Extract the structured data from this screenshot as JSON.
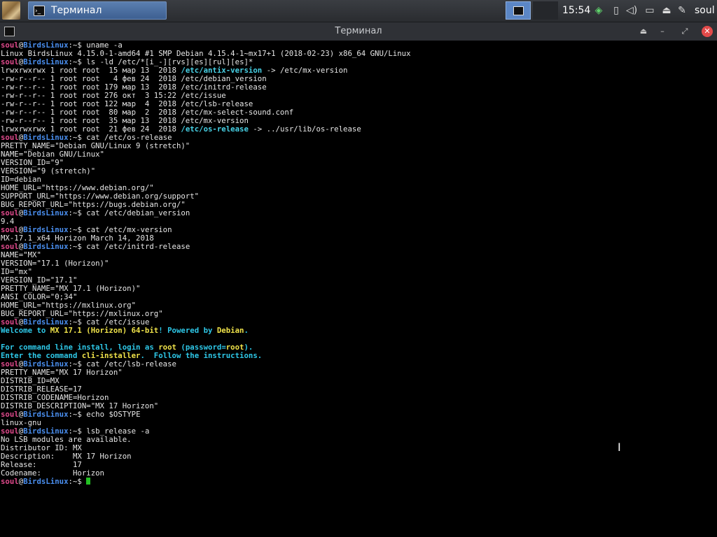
{
  "panel": {
    "task_title": "Терминал",
    "clock": "15:54",
    "user": "soul",
    "tray_icons": [
      "network-cube-icon",
      "clipboard-icon",
      "volume-icon",
      "battery-icon",
      "eject-icon",
      "pen-icon"
    ]
  },
  "window": {
    "title": "Терминал",
    "buttons": [
      "shade-icon",
      "minimize-icon",
      "maximize-icon",
      "close-icon"
    ]
  },
  "prompt": {
    "user": "soul",
    "at": "@",
    "host": "BirdsLinux",
    "suffix": ":~$ "
  },
  "terminal_lines": [
    {
      "cmd": "uname -a"
    },
    {
      "t": "Linux BirdsLinux 4.15.0-1-amd64 #1 SMP Debian 4.15.4-1~mx17+1 (2018-02-23) x86_64 GNU/Linux"
    },
    {
      "cmd": "ls -ld /etc/*[i_-][rvs][es][rul][es]*"
    },
    {
      "t": "lrwxrwxrwx 1 root root  15 мар 13  2018 ",
      "link": "/etc/antix-version",
      "t2": " -> /etc/mx-version"
    },
    {
      "t": "-rw-r--r-- 1 root root   4 фев 24  2018 /etc/debian_version"
    },
    {
      "t": "-rw-r--r-- 1 root root 179 мар 13  2018 /etc/initrd-release"
    },
    {
      "t": "-rw-r--r-- 1 root root 276 окт  3 15:22 /etc/issue"
    },
    {
      "t": "-rw-r--r-- 1 root root 122 мар  4  2018 /etc/lsb-release"
    },
    {
      "t": "-rw-r--r-- 1 root root  80 мар  2  2018 /etc/mx-select-sound.conf"
    },
    {
      "t": "-rw-r--r-- 1 root root  35 мар 13  2018 /etc/mx-version"
    },
    {
      "t": "lrwxrwxrwx 1 root root  21 фев 24  2018 ",
      "link": "/etc/os-release",
      "t2": " -> ../usr/lib/os-release"
    },
    {
      "cmd": "cat /etc/os-release"
    },
    {
      "t": "PRETTY_NAME=\"Debian GNU/Linux 9 (stretch)\""
    },
    {
      "t": "NAME=\"Debian GNU/Linux\""
    },
    {
      "t": "VERSION_ID=\"9\""
    },
    {
      "t": "VERSION=\"9 (stretch)\""
    },
    {
      "t": "ID=debian"
    },
    {
      "t": "HOME_URL=\"https://www.debian.org/\""
    },
    {
      "t": "SUPPORT_URL=\"https://www.debian.org/support\""
    },
    {
      "t": "BUG_REPORT_URL=\"https://bugs.debian.org/\""
    },
    {
      "cmd": "cat /etc/debian_version"
    },
    {
      "t": "9.4"
    },
    {
      "cmd": "cat /etc/mx-version"
    },
    {
      "t": "MX-17.1_x64 Horizon March 14, 2018"
    },
    {
      "cmd": "cat /etc/initrd-release"
    },
    {
      "t": "NAME=\"MX\""
    },
    {
      "t": "VERSION=\"17.1 (Horizon)\""
    },
    {
      "t": "ID=\"mx\""
    },
    {
      "t": "VERSION_ID=\"17.1\""
    },
    {
      "t": "PRETTY_NAME=\"MX 17.1 (Horizon)\""
    },
    {
      "t": "ANSI_COLOR=\"0;34\""
    },
    {
      "t": "HOME_URL=\"https://mxlinux.org\""
    },
    {
      "t": "BUG_REPORT_URL=\"https://mxlinux.org\""
    },
    {
      "cmd": "cat /etc/issue"
    },
    {
      "parts": [
        [
          "c",
          "Welcome to "
        ],
        [
          "y",
          "MX 17.1 (Horizon) 64-bit"
        ],
        [
          "c",
          "! Powered by "
        ],
        [
          "y",
          "Debian"
        ],
        [
          "c",
          "."
        ]
      ]
    },
    {
      "t": ""
    },
    {
      "parts": [
        [
          "c",
          "For command line install, login as "
        ],
        [
          "y",
          "root"
        ],
        [
          "c",
          " (password="
        ],
        [
          "y",
          "root"
        ],
        [
          "c",
          ")."
        ]
      ]
    },
    {
      "parts": [
        [
          "c",
          "Enter the command "
        ],
        [
          "y",
          "cli-installer"
        ],
        [
          "c",
          ".  Follow the instructions."
        ]
      ]
    },
    {
      "cmd": "cat /etc/lsb-release"
    },
    {
      "t": "PRETTY_NAME=\"MX 17 Horizon\""
    },
    {
      "t": "DISTRIB_ID=MX"
    },
    {
      "t": "DISTRIB_RELEASE=17"
    },
    {
      "t": "DISTRIB_CODENAME=Horizon"
    },
    {
      "t": "DISTRIB_DESCRIPTION=\"MX 17 Horizon\""
    },
    {
      "cmd": "echo $OSTYPE"
    },
    {
      "t": "linux-gnu"
    },
    {
      "cmd": "lsb_release -a"
    },
    {
      "t": "No LSB modules are available."
    },
    {
      "t": "Distributor ID:\tMX"
    },
    {
      "t": "Description:\tMX 17 Horizon"
    },
    {
      "t": "Release:\t17"
    },
    {
      "t": "Codename:\tHorizon"
    },
    {
      "cmd": "",
      "cursor": true
    }
  ],
  "colors": {
    "user": "#e04a8c",
    "host": "#4a8ff0",
    "link": "#48d2e6",
    "issue_cyan": "#2ec8e8",
    "issue_yellow": "#f0e34a",
    "cursor": "#22c022"
  }
}
